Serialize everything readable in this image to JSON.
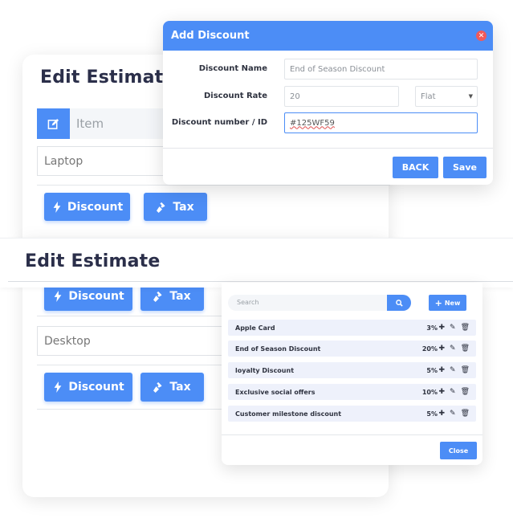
{
  "back_card": {
    "title": "Edit Estimate",
    "item_placeholder": "Item",
    "row1_value": "Laptop",
    "discount_label": "Discount",
    "tax_label": "Tax"
  },
  "add_discount_modal": {
    "title": "Add Discount",
    "close_icon": "close-icon",
    "name_label": "Discount Name",
    "name_value": "End of Season Discount",
    "rate_label": "Discount Rate",
    "rate_value": "20",
    "type_value": "Flat",
    "id_label": "Discount number / ID",
    "id_value": "#125WF59",
    "back_label": "BACK",
    "save_label": "Save"
  },
  "front_card": {
    "title": "Edit Estimate",
    "discount_label": "Discount",
    "tax_label": "Tax",
    "row2_value": "Desktop"
  },
  "discount_panel": {
    "search_placeholder": "Search",
    "new_label": "New",
    "items": [
      {
        "name": "Apple Card",
        "pct": "3%"
      },
      {
        "name": "End of Season Discount",
        "pct": "20%"
      },
      {
        "name": "loyalty Discount",
        "pct": "5%"
      },
      {
        "name": "Exclusive social offers",
        "pct": "10%"
      },
      {
        "name": "Customer milestone discount",
        "pct": "5%"
      }
    ],
    "close_label": "Close"
  },
  "colors": {
    "accent": "#4c8df6",
    "title_text": "#2b2f4a",
    "close_red": "#f15a5a",
    "row_bg": "#eef1fb"
  }
}
